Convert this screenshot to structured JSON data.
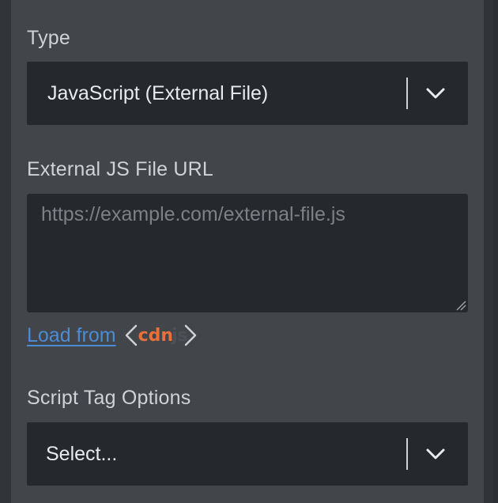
{
  "type_field": {
    "label": "Type",
    "value": "JavaScript (External File)"
  },
  "external_url_field": {
    "label": "External JS File URL",
    "placeholder": "https://example.com/external-file.js",
    "value": ""
  },
  "load_from": {
    "link_label": "Load from",
    "badge_text": "cdn",
    "badge_ghost": "js"
  },
  "script_tag_options": {
    "label": "Script Tag Options",
    "value": "Select..."
  },
  "colors": {
    "panel_bg": "#42464b",
    "input_bg": "#25282c",
    "link": "#4a8cd6",
    "cdn_accent": "#e8703a"
  },
  "icons": {
    "dropdown": "chevron-down-icon",
    "resize": "resize-grip-icon",
    "cdn_brackets": "angle-brackets-icon"
  }
}
